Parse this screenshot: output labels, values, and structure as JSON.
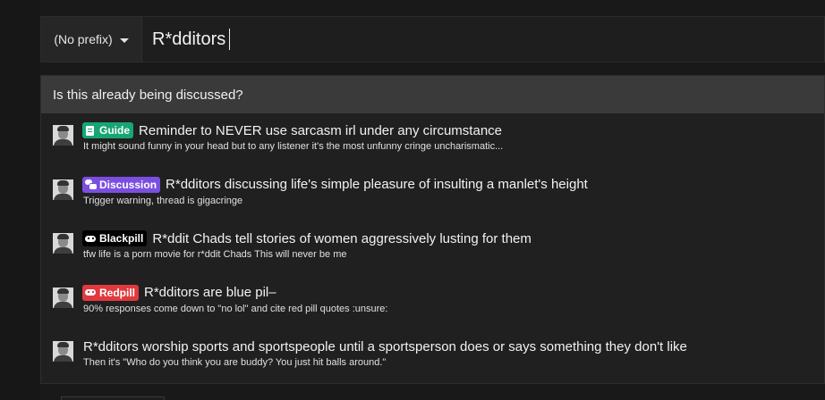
{
  "form": {
    "prefix_label": "(No prefix)",
    "title_value": "R*dditors"
  },
  "similar": {
    "header": "Is this already being discussed?",
    "threads": [
      {
        "badge": "Guide",
        "badge_icon": "book-icon",
        "badge_color": "#17a673",
        "title": "Reminder to NEVER use sarcasm irl under any circumstance",
        "snippet": "It might sound funny in your head but to any listener it's the most unfunny cringe uncharismatic..."
      },
      {
        "badge": "Discussion",
        "badge_icon": "chat-bubbles-icon",
        "badge_color": "#7a4fe0",
        "title": "R*dditors discussing life's simple pleasure of insulting a manlet's height",
        "snippet": "Trigger warning, thread is gigacringe"
      },
      {
        "badge": "Blackpill",
        "badge_icon": "gamepad-icon",
        "badge_color": "#000000",
        "title": "R*ddit Chads tell stories of women aggressively lusting for them",
        "snippet": "tfw life is a porn movie for r*ddit Chads This will never be me"
      },
      {
        "badge": "Redpill",
        "badge_icon": "gamepad-icon",
        "badge_color": "#e0393e",
        "title": "R*dditors are blue pil–",
        "snippet": "90% responses come down to \"no lol\" and cite red pill quotes :unsure:"
      },
      {
        "badge": "",
        "badge_icon": "",
        "badge_color": "",
        "title": "R*dditors worship sports and sportspeople until a sportsperson does or says something they don't like",
        "snippet": "Then it's \"Who do you think you are buddy? You just hit balls around.\""
      }
    ]
  }
}
